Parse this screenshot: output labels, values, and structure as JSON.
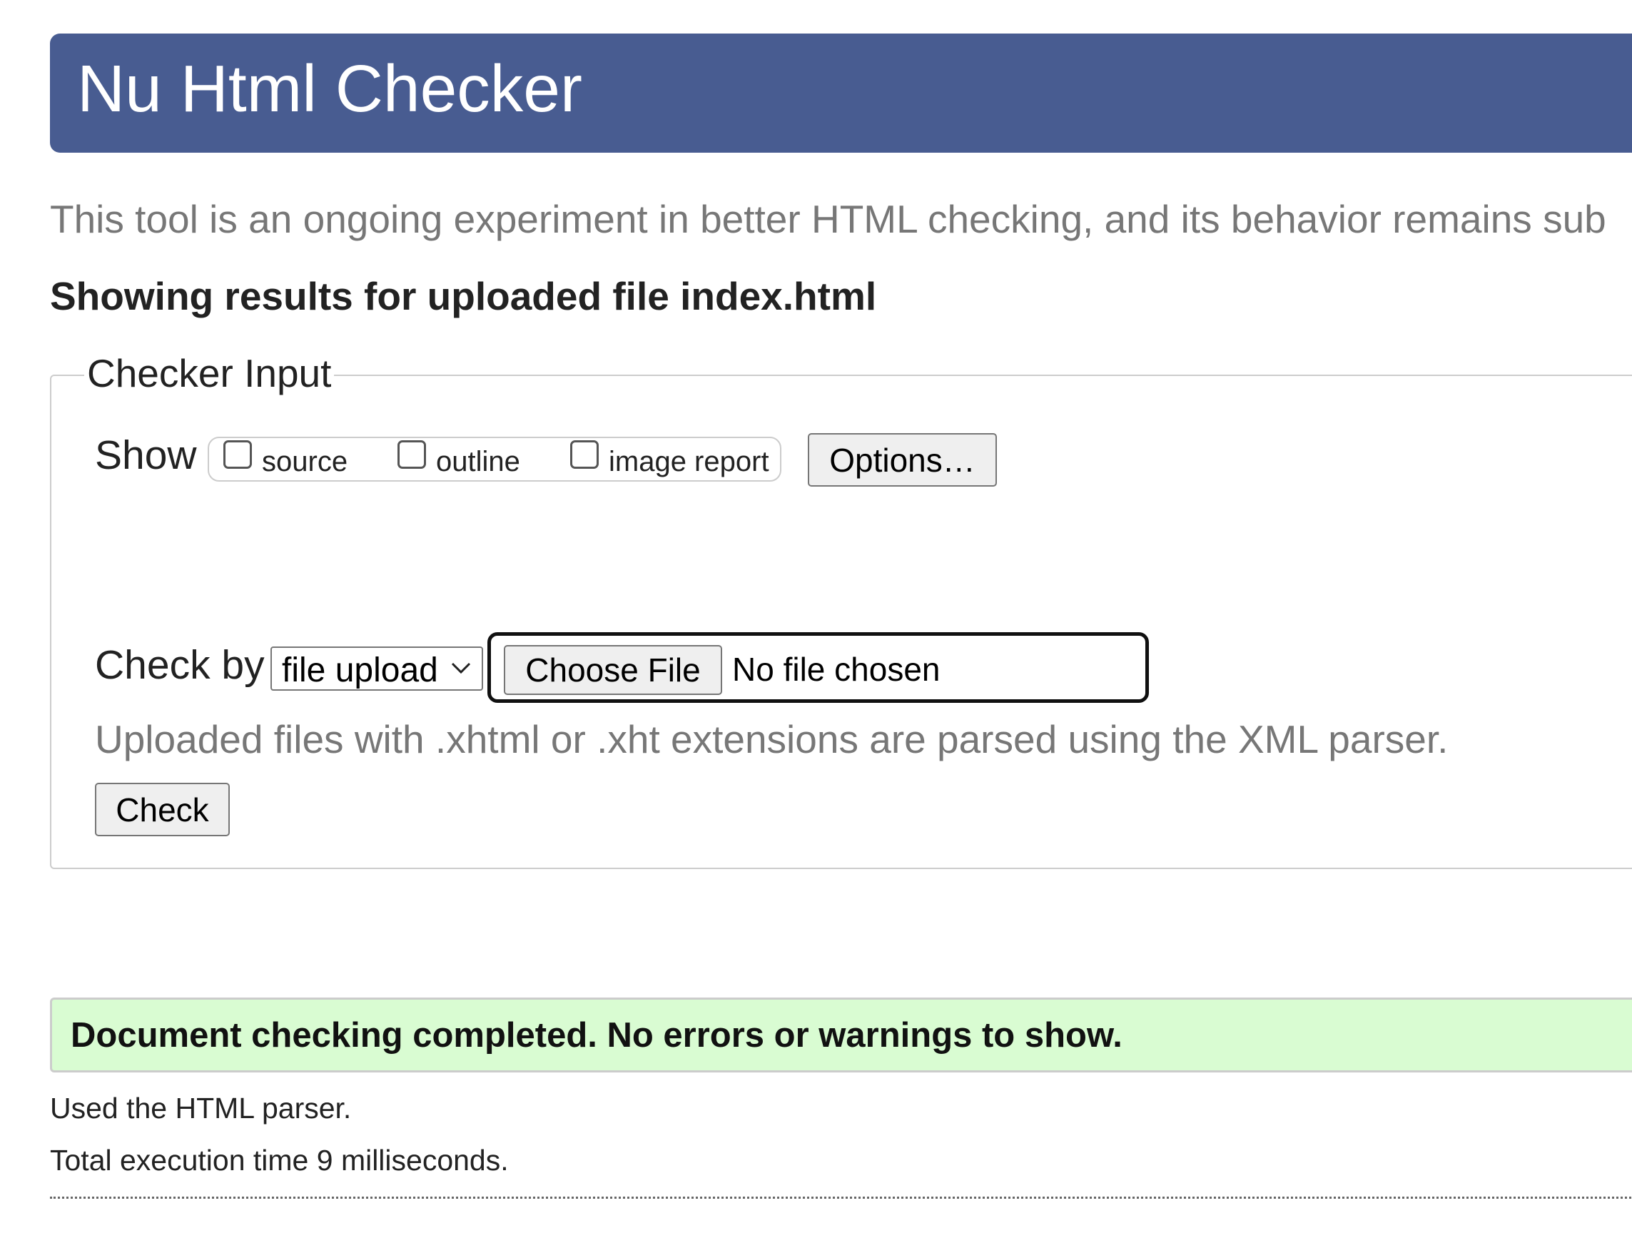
{
  "header": {
    "title": "Nu Html Checker",
    "background_color": "#485c91"
  },
  "intro_text": "This tool is an ongoing experiment in better HTML checking, and its behavior remains sub",
  "results_heading": "Showing results for uploaded file index.html",
  "checker_input": {
    "legend": "Checker Input",
    "show_label": "Show",
    "show_options": [
      {
        "label": "source",
        "checked": false
      },
      {
        "label": "outline",
        "checked": false
      },
      {
        "label": "image report",
        "checked": false
      }
    ],
    "options_button": "Options…",
    "check_by_label": "Check by",
    "check_by_select": {
      "selected": "file upload",
      "icon": "chevron-down-icon"
    },
    "choose_file_button": "Choose File",
    "file_status": "No file chosen",
    "upload_hint": "Uploaded files with .xhtml or .xht extensions are parsed using the XML parser.",
    "check_button": "Check"
  },
  "result": {
    "message": "Document checking completed. No errors or warnings to show.",
    "background_color": "#d9fcd2",
    "parser_line": "Used the HTML parser.",
    "execution_time_line": "Total execution time 9 milliseconds."
  }
}
